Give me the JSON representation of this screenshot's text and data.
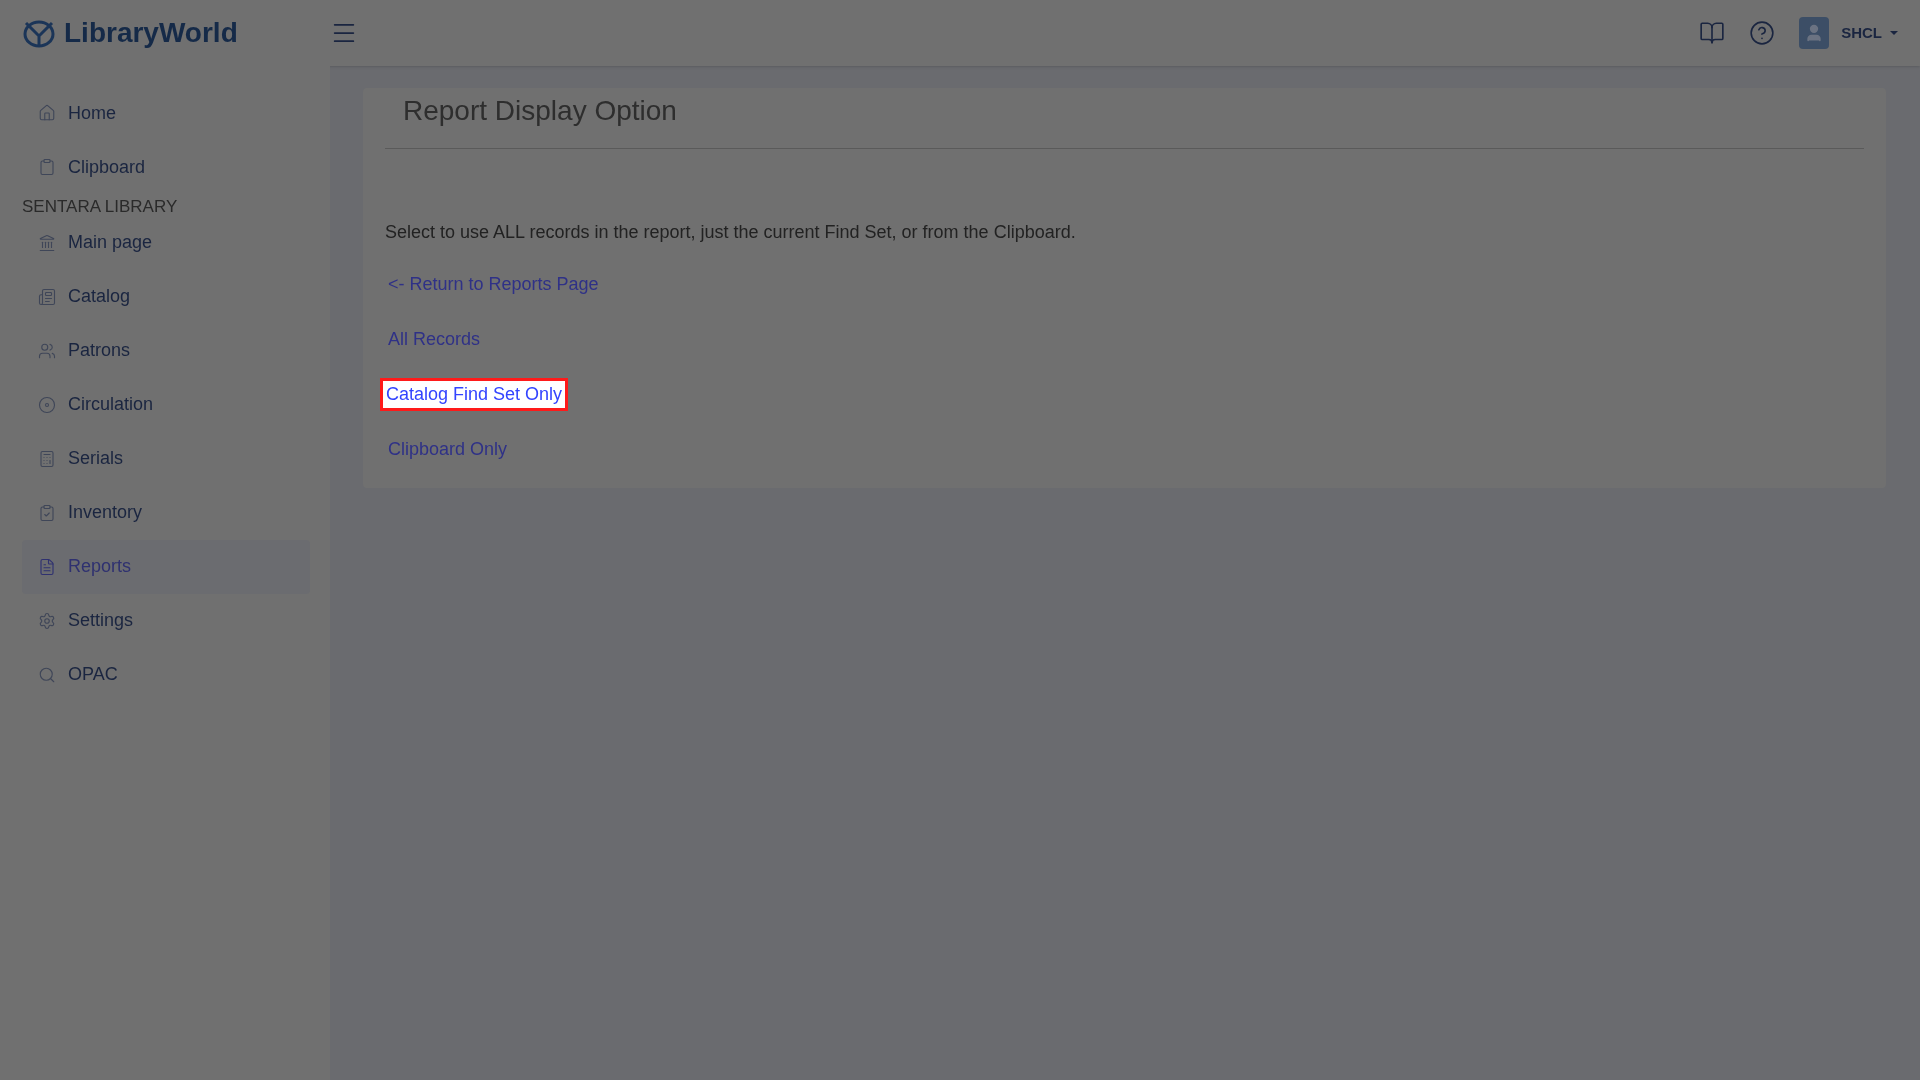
{
  "header": {
    "logo": "LibraryWorld",
    "user": "SHCL"
  },
  "sidebar": {
    "top_items": [
      {
        "label": "Home",
        "selected": false
      },
      {
        "label": "Clipboard",
        "selected": false
      }
    ],
    "section_title": "SENTARA LIBRARY",
    "items": [
      {
        "label": "Main page",
        "selected": false
      },
      {
        "label": "Catalog",
        "selected": false
      },
      {
        "label": "Patrons",
        "selected": false
      },
      {
        "label": "Circulation",
        "selected": false
      },
      {
        "label": "Serials",
        "selected": false
      },
      {
        "label": "Inventory",
        "selected": false
      },
      {
        "label": "Reports",
        "selected": true
      },
      {
        "label": "Settings",
        "selected": false
      },
      {
        "label": "OPAC",
        "selected": false
      }
    ]
  },
  "card": {
    "title": "Report Display Option",
    "description": "Select to use ALL records in the report, just the current Find Set, or from the Clipboard.",
    "links": [
      {
        "label": "<- Return to Reports Page",
        "highlighted": false
      },
      {
        "label": "All Records",
        "highlighted": false
      },
      {
        "label": "Catalog Find Set Only",
        "highlighted": true
      },
      {
        "label": "Clipboard Only",
        "highlighted": false
      }
    ]
  }
}
